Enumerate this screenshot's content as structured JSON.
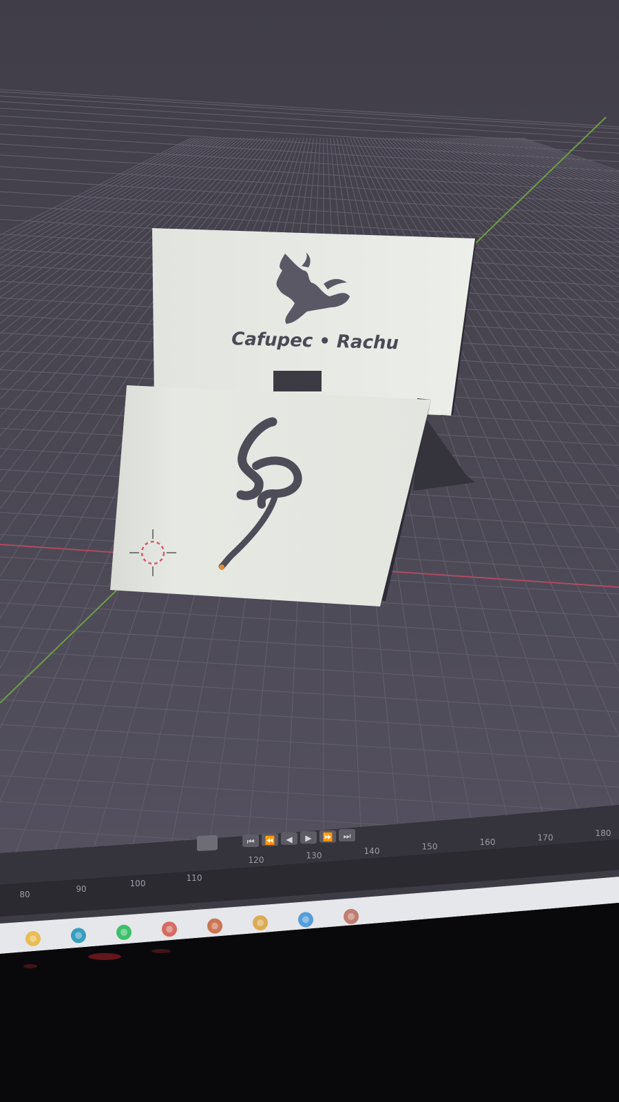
{
  "viewport": {
    "background_color": "#4a4753",
    "grid_color": "#5f5c69",
    "x_axis_color": "#b34a5e",
    "y_axis_color": "#6fa045"
  },
  "back_sign": {
    "text": "Cafupec • Rachu",
    "logo": "dancing-creature-logo",
    "color": "#e9ebe6"
  },
  "front_sign": {
    "logo": "ss-signature-logo",
    "color": "#e5e7e2"
  },
  "timeline": {
    "controls": [
      "jump-to-start-icon",
      "previous-keyframe-icon",
      "play-reverse-icon",
      "play-icon",
      "next-keyframe-icon",
      "jump-to-end-icon"
    ],
    "upper_ticks": [
      "120",
      "130",
      "140",
      "150",
      "160",
      "170",
      "180"
    ],
    "lower_ticks": [
      "80",
      "90",
      "100",
      "110"
    ]
  },
  "taskbar": {
    "apps": [
      "file-explorer-icon",
      "edge-icon",
      "spotify-icon",
      "chrome-icon",
      "app-icon",
      "chrome-icon",
      "visual-studio-icon",
      "app-icon"
    ]
  }
}
